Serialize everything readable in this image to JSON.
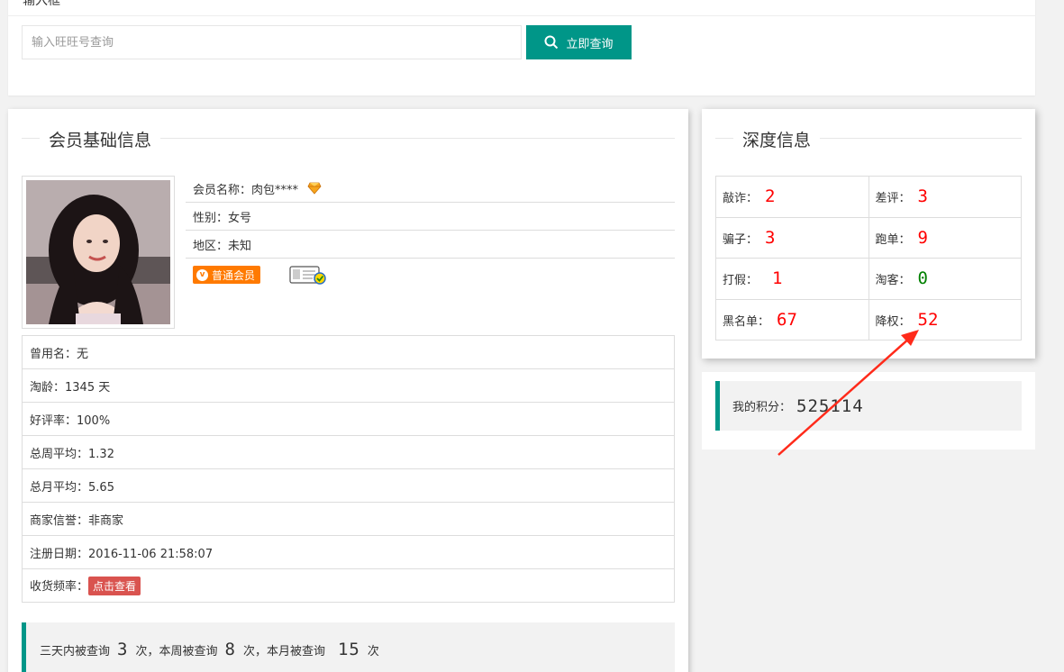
{
  "top": {
    "label": "输入框",
    "search_placeholder": "输入旺旺号查询",
    "search_button": "立即查询"
  },
  "member": {
    "section_title": "会员基础信息",
    "name_label": "会员名称：",
    "name_value": "肉包****",
    "gender_label": "性别：",
    "gender_value": "女号",
    "region_label": "地区：",
    "region_value": "未知",
    "badge_label": "普通会员",
    "details": [
      {
        "label": "曾用名：",
        "value": "无"
      },
      {
        "label": "淘龄：",
        "value": "1345 天"
      },
      {
        "label": "好评率：",
        "value": "100%"
      },
      {
        "label": "总周平均：",
        "value": "1.32"
      },
      {
        "label": "总月平均：",
        "value": "5.65"
      },
      {
        "label": "商家信誉：",
        "value": "非商家"
      },
      {
        "label": "注册日期：",
        "value": "2016-11-06 21:58:07"
      },
      {
        "label": "收货频率：",
        "value": ""
      }
    ],
    "view_button": "点击查看",
    "query": {
      "three_days_label": "三天内被查询",
      "three_days_value": "3",
      "week_label": "次，本周被查询",
      "week_value": "8",
      "month_label": "次，本月被查询",
      "month_value": "15",
      "suffix": "次"
    }
  },
  "deep": {
    "section_title": "深度信息",
    "cells": [
      {
        "label": "敲诈：",
        "value": "2",
        "color": "#ff0000"
      },
      {
        "label": "差评：",
        "value": "3",
        "color": "#ff0000"
      },
      {
        "label": "骗子：",
        "value": "3",
        "color": "#ff0000"
      },
      {
        "label": "跑单：",
        "value": "9",
        "color": "#ff0000"
      },
      {
        "label": "打假：",
        "value": "1",
        "color": "#ff0000"
      },
      {
        "label": "淘客：",
        "value": "0",
        "color": "#008000"
      },
      {
        "label": "黑名单：",
        "value": "67",
        "color": "#ff0000"
      },
      {
        "label": "降权：",
        "value": "52",
        "color": "#ff0000"
      }
    ]
  },
  "points": {
    "label": "我的积分：",
    "value": "525114"
  },
  "colors": {
    "accent": "#009688",
    "danger": "#d9534f",
    "badge": "#ff7a00"
  }
}
